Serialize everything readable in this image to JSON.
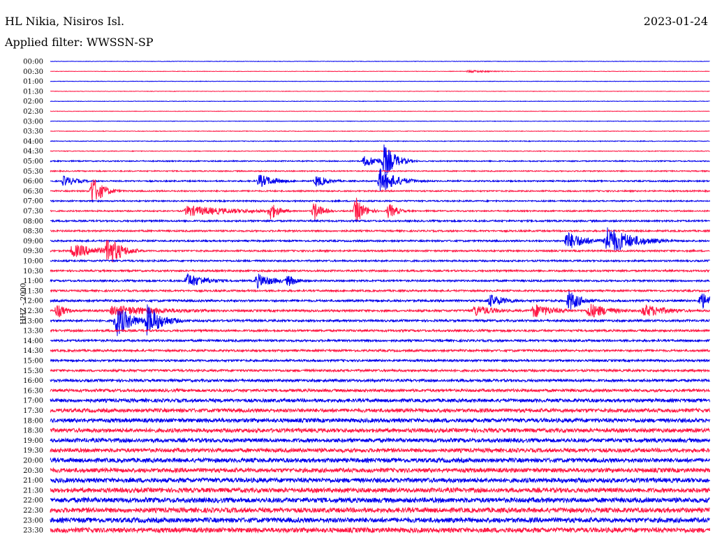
{
  "header": {
    "station": "HL Nikia, Nisiros Isl.",
    "date": "2023-01-24",
    "filter": "Applied filter: WWSSN-SP"
  },
  "channel_label": "HHZ - 2000",
  "colors": {
    "even_row": "#0000ee",
    "odd_row": "#ff1744"
  },
  "chart_data": {
    "type": "line",
    "title": "HL Nikia, Nisiros Isl.",
    "subtitle": "Applied filter: WWSSN-SP",
    "ylabel": "HHZ - 2000",
    "row_labels": [
      "00:00",
      "00:30",
      "01:00",
      "01:30",
      "02:00",
      "02:30",
      "03:00",
      "03:30",
      "04:00",
      "04:30",
      "05:00",
      "05:30",
      "06:00",
      "06:30",
      "07:00",
      "07:30",
      "08:00",
      "08:30",
      "09:00",
      "09:30",
      "10:00",
      "10:30",
      "11:00",
      "11:30",
      "12:00",
      "12:30",
      "13:00",
      "13:30",
      "14:00",
      "14:30",
      "15:00",
      "15:30",
      "16:00",
      "16:30",
      "17:00",
      "17:30",
      "18:00",
      "18:30",
      "19:00",
      "19:30",
      "20:00",
      "20:30",
      "21:00",
      "21:30",
      "22:00",
      "22:30",
      "23:00",
      "23:30"
    ],
    "row_window_minutes": 30,
    "row_colors": [
      "blue",
      "red"
    ],
    "background_noise": [
      0.3,
      0.3,
      0.3,
      0.3,
      0.35,
      0.35,
      0.35,
      0.4,
      0.5,
      0.5,
      0.8,
      0.8,
      1.0,
      1.0,
      1.0,
      1.0,
      1.2,
      1.2,
      1.2,
      1.2,
      1.2,
      1.3,
      1.3,
      1.3,
      1.5,
      1.5,
      1.5,
      1.5,
      1.5,
      1.5,
      1.5,
      1.6,
      1.8,
      2.0,
      2.4,
      2.6,
      2.8,
      2.8,
      2.8,
      2.8,
      3.0,
      3.0,
      3.2,
      3.2,
      3.4,
      3.4,
      3.4,
      3.4
    ],
    "events": [
      {
        "row": "00:30",
        "minute": 19.0,
        "amp": 2,
        "dur": 1.2
      },
      {
        "row": "05:00",
        "minute": 14.3,
        "amp": 8,
        "dur": 1.0
      },
      {
        "row": "05:00",
        "minute": 15.2,
        "amp": 26,
        "dur": 0.5
      },
      {
        "row": "06:00",
        "minute": 0.6,
        "amp": 8,
        "dur": 0.7
      },
      {
        "row": "06:00",
        "minute": 9.5,
        "amp": 10,
        "dur": 0.8
      },
      {
        "row": "06:00",
        "minute": 12.1,
        "amp": 9,
        "dur": 0.6
      },
      {
        "row": "06:00",
        "minute": 15.0,
        "amp": 18,
        "dur": 0.8
      },
      {
        "row": "06:30",
        "minute": 1.9,
        "amp": 22,
        "dur": 0.5
      },
      {
        "row": "07:30",
        "minute": 6.2,
        "amp": 8,
        "dur": 2.5
      },
      {
        "row": "07:30",
        "minute": 10.0,
        "amp": 14,
        "dur": 0.4
      },
      {
        "row": "07:30",
        "minute": 12.0,
        "amp": 14,
        "dur": 0.4
      },
      {
        "row": "07:30",
        "minute": 13.9,
        "amp": 20,
        "dur": 0.4
      },
      {
        "row": "07:30",
        "minute": 15.4,
        "amp": 12,
        "dur": 0.4
      },
      {
        "row": "09:00",
        "minute": 23.5,
        "amp": 14,
        "dur": 0.9
      },
      {
        "row": "09:00",
        "minute": 25.3,
        "amp": 22,
        "dur": 1.2
      },
      {
        "row": "09:30",
        "minute": 1.0,
        "amp": 10,
        "dur": 1.5
      },
      {
        "row": "09:30",
        "minute": 2.6,
        "amp": 25,
        "dur": 0.6
      },
      {
        "row": "11:00",
        "minute": 6.2,
        "amp": 11,
        "dur": 1.0
      },
      {
        "row": "11:00",
        "minute": 9.4,
        "amp": 11,
        "dur": 0.8
      },
      {
        "row": "11:00",
        "minute": 10.8,
        "amp": 9,
        "dur": 0.5
      },
      {
        "row": "12:00",
        "minute": 20.0,
        "amp": 10,
        "dur": 0.8
      },
      {
        "row": "12:00",
        "minute": 23.6,
        "amp": 16,
        "dur": 0.6
      },
      {
        "row": "12:00",
        "minute": 29.6,
        "amp": 14,
        "dur": 0.5
      },
      {
        "row": "12:30",
        "minute": 0.3,
        "amp": 12,
        "dur": 0.4
      },
      {
        "row": "12:30",
        "minute": 2.8,
        "amp": 8,
        "dur": 3.0
      },
      {
        "row": "12:30",
        "minute": 19.3,
        "amp": 9,
        "dur": 1.0
      },
      {
        "row": "12:30",
        "minute": 22.0,
        "amp": 11,
        "dur": 1.0
      },
      {
        "row": "12:30",
        "minute": 24.5,
        "amp": 12,
        "dur": 1.0
      },
      {
        "row": "12:30",
        "minute": 27.0,
        "amp": 10,
        "dur": 1.2
      },
      {
        "row": "13:00",
        "minute": 3.0,
        "amp": 24,
        "dur": 0.7
      },
      {
        "row": "13:00",
        "minute": 4.4,
        "amp": 24,
        "dur": 0.7
      },
      {
        "row": "22:00",
        "minute": 1.6,
        "amp": 6,
        "dur": 0.4
      }
    ]
  }
}
